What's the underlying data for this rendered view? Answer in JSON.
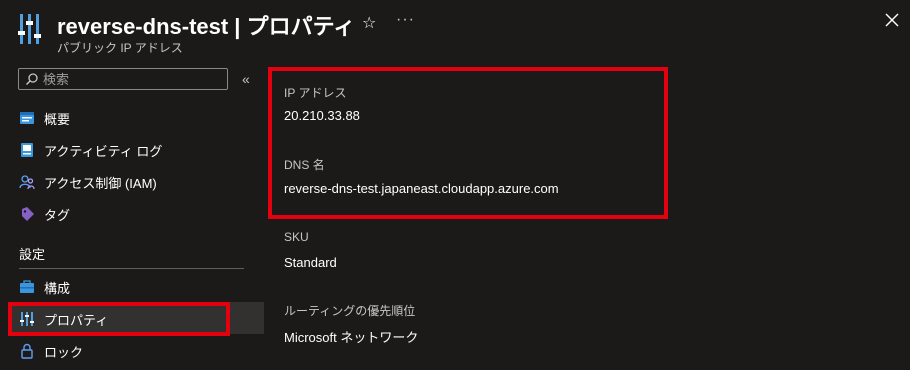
{
  "header": {
    "title": "reverse-dns-test | プロパティ",
    "subtitle": "パブリック IP アドレス",
    "star_icon": "star-icon",
    "more_label": "···",
    "close_icon": "close-icon",
    "resource_icon": "properties-icon"
  },
  "search": {
    "placeholder": "検索",
    "collapse_label": "«"
  },
  "sidebar": {
    "items": [
      {
        "label": "概要",
        "icon": "overview-icon"
      },
      {
        "label": "アクティビティ ログ",
        "icon": "activity-log-icon"
      },
      {
        "label": "アクセス制御 (IAM)",
        "icon": "iam-icon"
      },
      {
        "label": "タグ",
        "icon": "tag-icon"
      }
    ],
    "section_settings": "設定",
    "settings_items": [
      {
        "label": "構成",
        "icon": "configuration-icon"
      },
      {
        "label": "プロパティ",
        "icon": "properties-icon",
        "selected": true
      },
      {
        "label": "ロック",
        "icon": "lock-icon"
      }
    ]
  },
  "properties": {
    "ip_label": "IP アドレス",
    "ip_value": "20.210.33.88",
    "dns_label": "DNS 名",
    "dns_value": "reverse-dns-test.japaneast.cloudapp.azure.com",
    "sku_label": "SKU",
    "sku_value": "Standard",
    "routing_label": "ルーティングの優先順位",
    "routing_value": "Microsoft ネットワーク"
  },
  "colors": {
    "background": "#1b1a19",
    "selected_background": "#323130",
    "highlight": "#e3000f",
    "accent": "#0078d4"
  }
}
